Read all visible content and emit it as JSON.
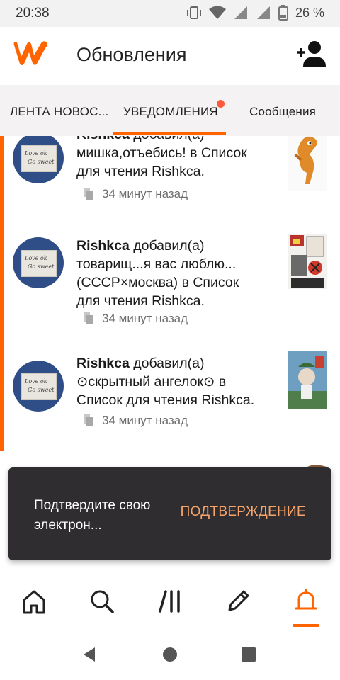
{
  "status": {
    "time": "20:38",
    "battery": "26 %"
  },
  "header": {
    "title": "Обновления"
  },
  "tabs": [
    {
      "label": "ЛЕНТА НОВОС..."
    },
    {
      "label": "УВЕДОМЛЕНИЯ"
    },
    {
      "label": "Сообщения"
    }
  ],
  "notifications": [
    {
      "user": "Rishkca",
      "action": " добавил(а)",
      "lines": [
        "мишка,отъебись! в Список",
        "для чтения Rishkca."
      ],
      "time": "34 минут назад"
    },
    {
      "user": "Rishkca",
      "action": " добавил(а)",
      "lines": [
        "товарищ...я вас люблю...",
        "(СССР×москва) в Список",
        "для чтения Rishkca."
      ],
      "time": "34 минут назад"
    },
    {
      "user": "Rishkca",
      "action": " добавил(а)",
      "lines": [
        "⊙скрытный ангелок⊙ в",
        "Список для чтения Rishkca."
      ],
      "time": "34 минут назад"
    }
  ],
  "snackbar": {
    "message": "Подтвердите свою электрон...",
    "action": "ПОДТВЕРЖДЕНИЕ"
  },
  "colors": {
    "accent": "#ff6400",
    "snackbar_bg": "#2f2d2f",
    "snackbar_action": "#f7a46b"
  },
  "nav_icons": [
    "home-icon",
    "search-icon",
    "library-icon",
    "write-icon",
    "notifications-icon"
  ]
}
